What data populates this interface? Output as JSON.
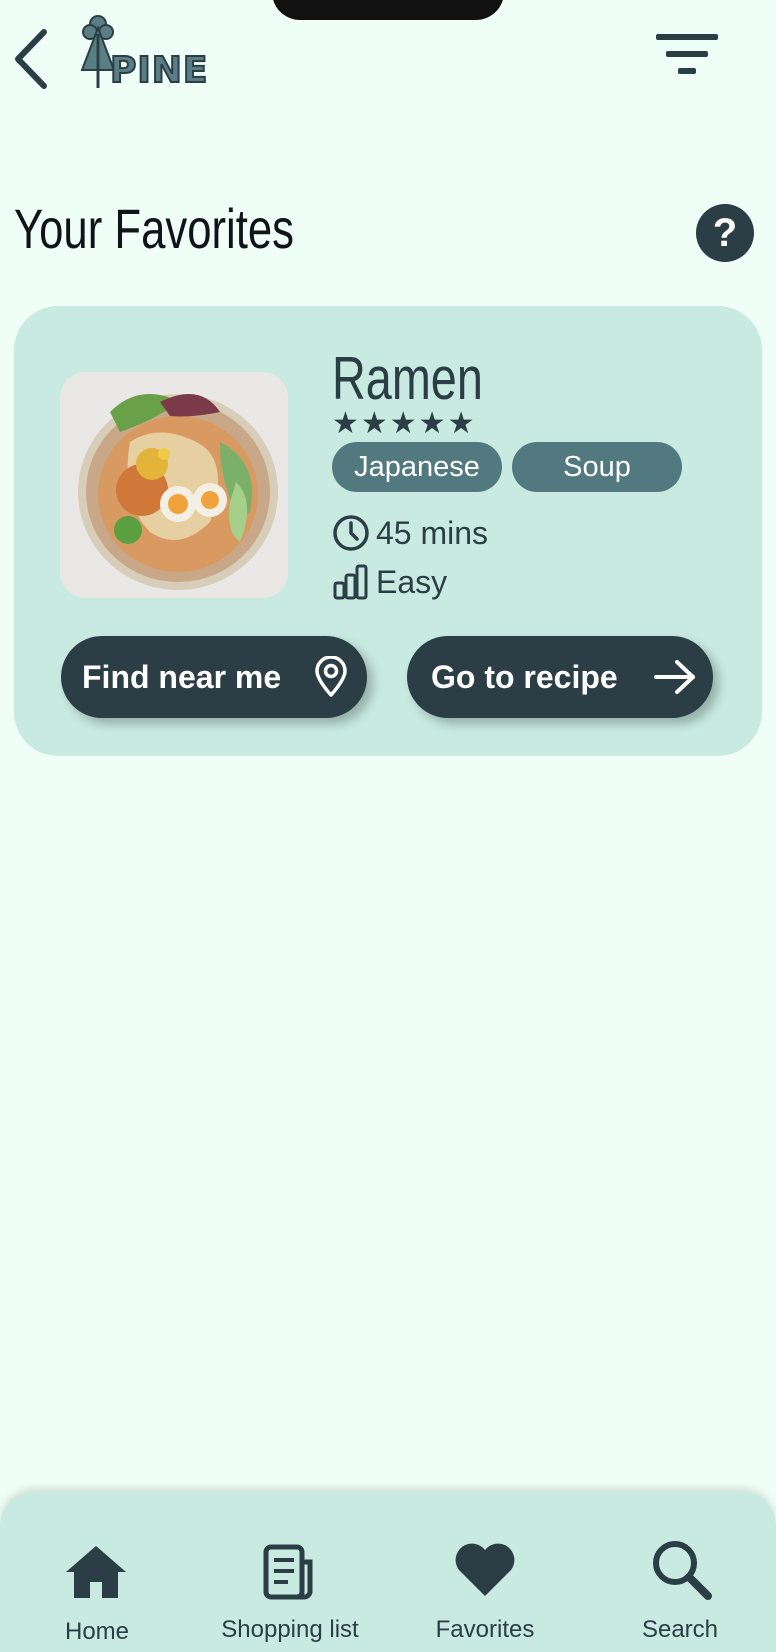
{
  "header": {
    "logo_text": "PINE",
    "back_icon": "chevron-left-icon",
    "filter_icon": "filter-icon"
  },
  "page": {
    "title": "Your Favorites",
    "help_label": "?"
  },
  "favorites": [
    {
      "name": "Ramen",
      "rating": 5,
      "rating_display": "★★★★★",
      "tags": [
        "Japanese",
        "Soup"
      ],
      "time": "45 mins",
      "difficulty": "Easy",
      "find_button": "Find near me",
      "recipe_button": "Go to recipe"
    }
  ],
  "nav": {
    "items": [
      {
        "label": "Home",
        "icon": "home-icon"
      },
      {
        "label": "Shopping list",
        "icon": "shopping-list-icon"
      },
      {
        "label": "Favorites",
        "icon": "heart-icon"
      },
      {
        "label": "Search",
        "icon": "search-icon"
      }
    ]
  },
  "colors": {
    "background": "#effff7",
    "card": "#c8eae0",
    "primary": "#2b3d45",
    "tag": "#527880"
  }
}
